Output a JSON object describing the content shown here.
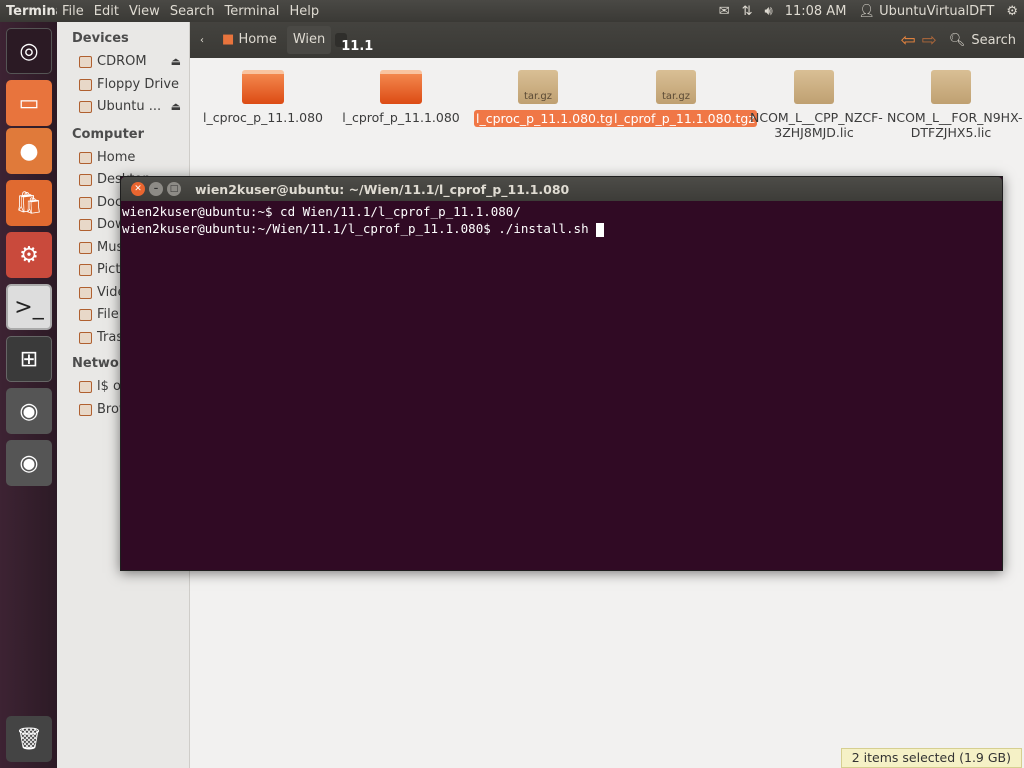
{
  "panel": {
    "app": "Terminal",
    "menus": [
      "File",
      "Edit",
      "View",
      "Search",
      "Terminal",
      "Help"
    ],
    "time": "11:08 AM",
    "user": "UbuntuVirtualDFT"
  },
  "sidebar": {
    "devices_title": "Devices",
    "devices": [
      "CDROM",
      "Floppy Drive",
      "Ubuntu ..."
    ],
    "computer_title": "Computer",
    "computer": [
      "Home",
      "Desktop",
      "Documents",
      "Downloads",
      "Music",
      "Pictures",
      "Videos",
      "File System",
      "Trash"
    ],
    "network_title": "Network",
    "network": [
      "l$ o",
      "Browse Network"
    ]
  },
  "toolbar": {
    "breadcrumbs": [
      "Home",
      "Wien",
      "11.1"
    ],
    "search_label": "Search"
  },
  "files": [
    {
      "name": "l_cproc_p_11.1.080",
      "type": "folder"
    },
    {
      "name": "l_cprof_p_11.1.080",
      "type": "folder"
    },
    {
      "name": "l_cproc_p_11.1.080.tgz",
      "type": "tar.gz",
      "selected": true
    },
    {
      "name": "l_cprof_p_11.1.080.tgz",
      "type": "tar.gz",
      "selected": true
    },
    {
      "name": "NCOM_L__CPP_NZCF-3ZHJ8MJD.lic",
      "type": "package"
    },
    {
      "name": "NCOM_L__FOR_N9HX-DTFZJHX5.lic",
      "type": "package"
    }
  ],
  "file_icon_label": "tar.gz",
  "terminal": {
    "title": "wien2kuser@ubuntu: ~/Wien/11.1/l_cprof_p_11.1.080",
    "lines": [
      "wien2kuser@ubuntu:~$ cd Wien/11.1/l_cprof_p_11.1.080/",
      "wien2kuser@ubuntu:~/Wien/11.1/l_cprof_p_11.1.080$ ./install.sh "
    ]
  },
  "status": "2 items selected (1.9 GB)"
}
